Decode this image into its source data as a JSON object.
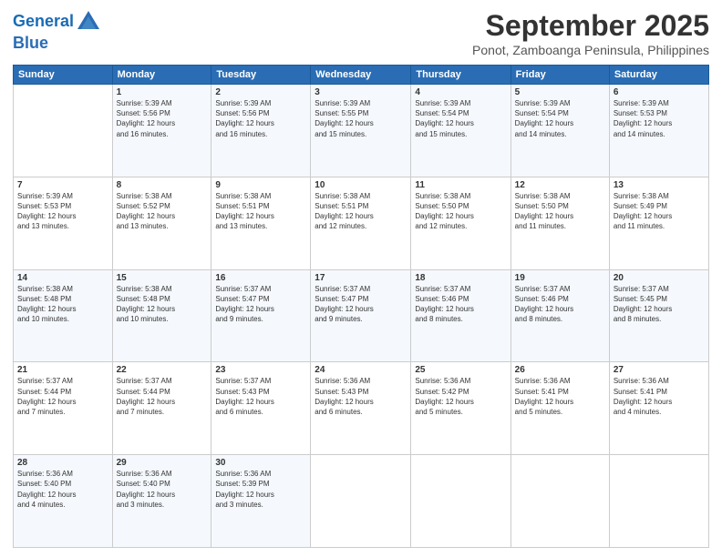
{
  "logo": {
    "line1": "General",
    "line2": "Blue"
  },
  "header": {
    "month": "September 2025",
    "location": "Ponot, Zamboanga Peninsula, Philippines"
  },
  "weekdays": [
    "Sunday",
    "Monday",
    "Tuesday",
    "Wednesday",
    "Thursday",
    "Friday",
    "Saturday"
  ],
  "rows": [
    [
      {
        "num": "",
        "info": ""
      },
      {
        "num": "1",
        "info": "Sunrise: 5:39 AM\nSunset: 5:56 PM\nDaylight: 12 hours\nand 16 minutes."
      },
      {
        "num": "2",
        "info": "Sunrise: 5:39 AM\nSunset: 5:56 PM\nDaylight: 12 hours\nand 16 minutes."
      },
      {
        "num": "3",
        "info": "Sunrise: 5:39 AM\nSunset: 5:55 PM\nDaylight: 12 hours\nand 15 minutes."
      },
      {
        "num": "4",
        "info": "Sunrise: 5:39 AM\nSunset: 5:54 PM\nDaylight: 12 hours\nand 15 minutes."
      },
      {
        "num": "5",
        "info": "Sunrise: 5:39 AM\nSunset: 5:54 PM\nDaylight: 12 hours\nand 14 minutes."
      },
      {
        "num": "6",
        "info": "Sunrise: 5:39 AM\nSunset: 5:53 PM\nDaylight: 12 hours\nand 14 minutes."
      }
    ],
    [
      {
        "num": "7",
        "info": "Sunrise: 5:39 AM\nSunset: 5:53 PM\nDaylight: 12 hours\nand 13 minutes."
      },
      {
        "num": "8",
        "info": "Sunrise: 5:38 AM\nSunset: 5:52 PM\nDaylight: 12 hours\nand 13 minutes."
      },
      {
        "num": "9",
        "info": "Sunrise: 5:38 AM\nSunset: 5:51 PM\nDaylight: 12 hours\nand 13 minutes."
      },
      {
        "num": "10",
        "info": "Sunrise: 5:38 AM\nSunset: 5:51 PM\nDaylight: 12 hours\nand 12 minutes."
      },
      {
        "num": "11",
        "info": "Sunrise: 5:38 AM\nSunset: 5:50 PM\nDaylight: 12 hours\nand 12 minutes."
      },
      {
        "num": "12",
        "info": "Sunrise: 5:38 AM\nSunset: 5:50 PM\nDaylight: 12 hours\nand 11 minutes."
      },
      {
        "num": "13",
        "info": "Sunrise: 5:38 AM\nSunset: 5:49 PM\nDaylight: 12 hours\nand 11 minutes."
      }
    ],
    [
      {
        "num": "14",
        "info": "Sunrise: 5:38 AM\nSunset: 5:48 PM\nDaylight: 12 hours\nand 10 minutes."
      },
      {
        "num": "15",
        "info": "Sunrise: 5:38 AM\nSunset: 5:48 PM\nDaylight: 12 hours\nand 10 minutes."
      },
      {
        "num": "16",
        "info": "Sunrise: 5:37 AM\nSunset: 5:47 PM\nDaylight: 12 hours\nand 9 minutes."
      },
      {
        "num": "17",
        "info": "Sunrise: 5:37 AM\nSunset: 5:47 PM\nDaylight: 12 hours\nand 9 minutes."
      },
      {
        "num": "18",
        "info": "Sunrise: 5:37 AM\nSunset: 5:46 PM\nDaylight: 12 hours\nand 8 minutes."
      },
      {
        "num": "19",
        "info": "Sunrise: 5:37 AM\nSunset: 5:46 PM\nDaylight: 12 hours\nand 8 minutes."
      },
      {
        "num": "20",
        "info": "Sunrise: 5:37 AM\nSunset: 5:45 PM\nDaylight: 12 hours\nand 8 minutes."
      }
    ],
    [
      {
        "num": "21",
        "info": "Sunrise: 5:37 AM\nSunset: 5:44 PM\nDaylight: 12 hours\nand 7 minutes."
      },
      {
        "num": "22",
        "info": "Sunrise: 5:37 AM\nSunset: 5:44 PM\nDaylight: 12 hours\nand 7 minutes."
      },
      {
        "num": "23",
        "info": "Sunrise: 5:37 AM\nSunset: 5:43 PM\nDaylight: 12 hours\nand 6 minutes."
      },
      {
        "num": "24",
        "info": "Sunrise: 5:36 AM\nSunset: 5:43 PM\nDaylight: 12 hours\nand 6 minutes."
      },
      {
        "num": "25",
        "info": "Sunrise: 5:36 AM\nSunset: 5:42 PM\nDaylight: 12 hours\nand 5 minutes."
      },
      {
        "num": "26",
        "info": "Sunrise: 5:36 AM\nSunset: 5:41 PM\nDaylight: 12 hours\nand 5 minutes."
      },
      {
        "num": "27",
        "info": "Sunrise: 5:36 AM\nSunset: 5:41 PM\nDaylight: 12 hours\nand 4 minutes."
      }
    ],
    [
      {
        "num": "28",
        "info": "Sunrise: 5:36 AM\nSunset: 5:40 PM\nDaylight: 12 hours\nand 4 minutes."
      },
      {
        "num": "29",
        "info": "Sunrise: 5:36 AM\nSunset: 5:40 PM\nDaylight: 12 hours\nand 3 minutes."
      },
      {
        "num": "30",
        "info": "Sunrise: 5:36 AM\nSunset: 5:39 PM\nDaylight: 12 hours\nand 3 minutes."
      },
      {
        "num": "",
        "info": ""
      },
      {
        "num": "",
        "info": ""
      },
      {
        "num": "",
        "info": ""
      },
      {
        "num": "",
        "info": ""
      }
    ]
  ]
}
